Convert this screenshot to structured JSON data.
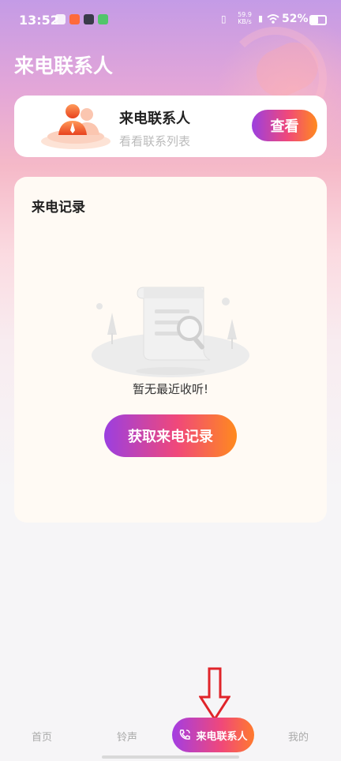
{
  "status_bar": {
    "time": "13:52",
    "net_speed_value": "59.9",
    "net_speed_unit": "KB/s",
    "battery": "52%"
  },
  "header": {
    "title": "来电联系人"
  },
  "contacts_card": {
    "title": "来电联系人",
    "subtitle": "看看联系列表",
    "button_label": "查看"
  },
  "records_card": {
    "title": "来电记录",
    "empty_text": "暂无最近收听!",
    "button_label": "获取来电记录"
  },
  "nav": {
    "items": [
      {
        "label": "首页"
      },
      {
        "label": "铃声"
      },
      {
        "label": "来电联系人"
      },
      {
        "label": "我的"
      }
    ],
    "active_index": 2
  },
  "colors": {
    "accent_start": "#9b3fe0",
    "accent_mid": "#f0487a",
    "accent_end": "#ff8a1e",
    "annotation_arrow": "#e0242a"
  }
}
